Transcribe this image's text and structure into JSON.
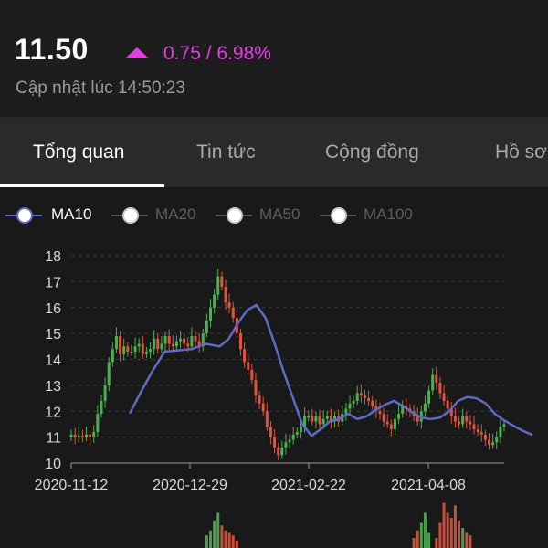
{
  "quote": {
    "price": "11.50",
    "change": "0.75 / 6.98%",
    "updated": "Cập nhật lúc 14:50:23"
  },
  "colors": {
    "up": "#e340e3",
    "candle_up": "#4caf50",
    "candle_down": "#e0533d",
    "ma_line": "#5d6bc6"
  },
  "tabs": [
    {
      "label": "Tổng quan",
      "active": true
    },
    {
      "label": "Tin tức",
      "active": false
    },
    {
      "label": "Cộng đồng",
      "active": false
    },
    {
      "label": "Hồ sơ",
      "active": false
    }
  ],
  "legend": [
    {
      "label": "MA10",
      "active": true
    },
    {
      "label": "MA20",
      "active": false
    },
    {
      "label": "MA50",
      "active": false
    },
    {
      "label": "MA100",
      "active": false
    }
  ],
  "chart_data": {
    "type": "candlestick",
    "ylim": [
      10,
      18
    ],
    "yticks": [
      "10",
      "11",
      "12",
      "13",
      "14",
      "15",
      "16",
      "17",
      "18"
    ],
    "xlabels": [
      "2020-11-12",
      "2020-12-29",
      "2021-02-22",
      "2021-04-08"
    ],
    "grid": true,
    "series": [
      {
        "name": "MA10",
        "type": "line",
        "values": [
          [
            9,
            11.95
          ],
          [
            14,
            12.8
          ],
          [
            19,
            13.6
          ],
          [
            24,
            14.3
          ],
          [
            30,
            14.35
          ],
          [
            36,
            14.4
          ],
          [
            42,
            14.6
          ],
          [
            48,
            14.5
          ],
          [
            52,
            14.8
          ],
          [
            56,
            15.4
          ],
          [
            60,
            15.9
          ],
          [
            64,
            16.1
          ],
          [
            68,
            15.6
          ],
          [
            72,
            14.6
          ],
          [
            76,
            13.5
          ],
          [
            80,
            12.5
          ],
          [
            84,
            11.5
          ],
          [
            88,
            11.05
          ],
          [
            92,
            11.3
          ],
          [
            96,
            11.6
          ],
          [
            100,
            11.7
          ],
          [
            104,
            11.9
          ],
          [
            108,
            11.7
          ],
          [
            112,
            11.8
          ],
          [
            116,
            12.05
          ],
          [
            120,
            12.25
          ],
          [
            124,
            12.4
          ],
          [
            128,
            12.2
          ],
          [
            132,
            11.95
          ],
          [
            136,
            11.75
          ],
          [
            140,
            11.7
          ],
          [
            144,
            11.75
          ],
          [
            148,
            12.0
          ],
          [
            152,
            12.4
          ],
          [
            156,
            12.55
          ],
          [
            160,
            12.5
          ],
          [
            164,
            12.3
          ],
          [
            168,
            11.9
          ],
          [
            172,
            11.65
          ],
          [
            176,
            11.45
          ],
          [
            180,
            11.25
          ],
          [
            184,
            11.1
          ]
        ]
      }
    ],
    "candles_close": [
      11.1,
      11.0,
      11.05,
      11.0,
      11.1,
      11.0,
      11.2,
      11.9,
      12.4,
      13.0,
      13.9,
      14.4,
      14.9,
      14.2,
      14.5,
      14.3,
      14.3,
      14.5,
      14.6,
      14.2,
      14.3,
      14.4,
      14.8,
      14.4,
      14.6,
      14.9,
      14.6,
      14.5,
      14.7,
      14.8,
      14.6,
      14.5,
      14.9,
      14.7,
      14.5,
      15.0,
      15.5,
      16.0,
      16.5,
      17.2,
      16.8,
      16.2,
      16.0,
      15.6,
      15.0,
      14.4,
      13.9,
      13.6,
      13.2,
      12.6,
      12.3,
      12.0,
      11.4,
      11.0,
      10.6,
      10.3,
      10.6,
      10.8,
      10.9,
      11.1,
      11.2,
      11.4,
      11.8,
      11.8,
      11.6,
      11.8,
      11.5,
      11.7,
      11.8,
      11.6,
      11.8,
      11.6,
      11.9,
      12.1,
      12.3,
      12.4,
      12.7,
      12.6,
      12.5,
      12.4,
      12.2,
      12.0,
      11.9,
      11.6,
      11.5,
      11.3,
      11.7,
      11.9,
      12.2,
      12.1,
      12.0,
      11.8,
      11.6,
      12.0,
      12.3,
      12.8,
      13.4,
      13.1,
      12.7,
      12.4,
      12.1,
      11.8,
      11.6,
      11.5,
      11.8,
      11.6,
      11.5,
      11.3,
      11.2,
      11.1,
      10.9,
      10.7,
      10.8,
      11.0,
      11.4,
      11.5
    ],
    "volume_relative": [
      0.0,
      0.0,
      0.0,
      0.0,
      0.0,
      0.0,
      0.0,
      0.0,
      0.0,
      0.0,
      0.0,
      0.0,
      0.0,
      0.0,
      0.0,
      0.0,
      0.0,
      0.0,
      0.0,
      0.0,
      0.0,
      0.0,
      0.0,
      0.0,
      0.0,
      0.0,
      0.0,
      0.0,
      0.0,
      0.0,
      0.0,
      0.0,
      0.0,
      0.0,
      0.0,
      0.0,
      0.25,
      0.35,
      0.55,
      0.7,
      0.45,
      0.35,
      0.3,
      0.25,
      0.15,
      0.0,
      0.0,
      0.0,
      0.0,
      0.0,
      0.0,
      0.0,
      0.0,
      0.0,
      0.0,
      0.0,
      0.0,
      0.0,
      0.0,
      0.0,
      0.0,
      0.0,
      0.0,
      0.0,
      0.0,
      0.0,
      0.0,
      0.0,
      0.0,
      0.0,
      0.0,
      0.0,
      0.0,
      0.0,
      0.0,
      0.0,
      0.0,
      0.0,
      0.0,
      0.0,
      0.0,
      0.0,
      0.0,
      0.0,
      0.0,
      0.0,
      0.0,
      0.0,
      0.0,
      0.0,
      0.0,
      0.2,
      0.35,
      0.5,
      0.7,
      0.3,
      0.0,
      0.2,
      0.5,
      0.9,
      0.7,
      0.6,
      0.85,
      0.55,
      0.4,
      0.3,
      0.25,
      0.0,
      0.0,
      0.0,
      0.0,
      0.0,
      0.0,
      0.0,
      0.0,
      0.0,
      0.0,
      0.0
    ]
  }
}
